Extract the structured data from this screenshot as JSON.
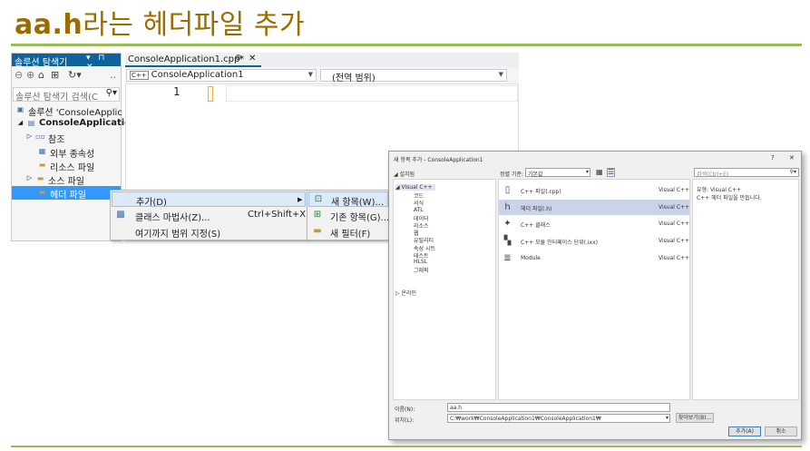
{
  "slide": {
    "title_bold": "aa.h",
    "title_rest": "라는 헤더파일 추가",
    "title_color": "#9c6b00",
    "accent_rule_color": "#9bbb59"
  },
  "solution_explorer": {
    "title": "솔루션 탐색기",
    "header_buttons": "▾ ⊓ ✕",
    "search_placeholder": "솔루션 탐색기 검색(C",
    "tree": [
      {
        "label": "솔루션 'ConsoleApplic",
        "icon": "solution-icon",
        "bold": false
      },
      {
        "label": "ConsoleApplicatic",
        "icon": "project-icon",
        "bold": true,
        "expander": "◢"
      },
      {
        "label": "참조",
        "icon": "references-icon",
        "expander": "▷"
      },
      {
        "label": "외부 종속성",
        "icon": "external-deps-icon"
      },
      {
        "label": "리소스 파일",
        "icon": "folder-icon"
      },
      {
        "label": "소스 파일",
        "icon": "folder-icon",
        "expander": "▷"
      },
      {
        "label": "헤더 파일",
        "icon": "folder-icon",
        "selected": true
      }
    ]
  },
  "editor": {
    "tab_label": "ConsoleApplication1.cpp*",
    "tab_pin": "⊕",
    "tab_close": "✕",
    "project_combo": "ConsoleApplication1",
    "scope_combo": "(전역 범위)",
    "line_number": "1"
  },
  "context_menu": {
    "items": [
      {
        "label": "추가(D)",
        "shortcut": "",
        "has_submenu": true,
        "highlighted": true
      },
      {
        "label": "클래스 마법사(Z)...",
        "shortcut": "Ctrl+Shift+X",
        "icon": "class-wizard-icon"
      },
      {
        "label": "여기까지 범위 지정(S)",
        "shortcut": ""
      }
    ],
    "submenu": [
      {
        "label": "새 항목(W)...",
        "icon": "new-item-icon",
        "highlighted": true
      },
      {
        "label": "기존 항목(G)...",
        "icon": "existing-item-icon"
      },
      {
        "label": "새 필터(F)",
        "icon": "new-filter-icon"
      }
    ]
  },
  "dialog": {
    "title": "새 항목 추가 - ConsoleApplication1",
    "help": "?",
    "close": "✕",
    "installed_label": "◢ 설치됨",
    "sort_label": "정렬 기준:",
    "sort_value": "기본값",
    "search_placeholder": "검색(Ctrl+E)",
    "left_tree": [
      "◢ Visual C++",
      "코드",
      "서식",
      "ATL",
      "데이터",
      "리소스",
      "웹",
      "유틸리티",
      "속성 시트",
      "테스트",
      "HLSL",
      "그래픽"
    ],
    "online": "▷ 온라인",
    "templates": [
      {
        "name": "C++ 파일(.cpp)",
        "lang": "Visual C++",
        "icon": "cpp-file-icon"
      },
      {
        "name": "헤더 파일(.h)",
        "lang": "Visual C++",
        "icon": "header-file-icon",
        "selected": true
      },
      {
        "name": "C++ 클래스",
        "lang": "Visual C++",
        "icon": "cpp-class-icon"
      },
      {
        "name": "C++ 모듈 인터페이스 단위(.ixx)",
        "lang": "Visual C++",
        "icon": "module-interface-icon"
      },
      {
        "name": "Module",
        "lang": "Visual C++",
        "icon": "module-icon"
      }
    ],
    "detail_type": "유형: Visual C++",
    "detail_desc": "C++ 헤더 파일을 만듭니다.",
    "name_label": "이름(N):",
    "name_value": "aa.h",
    "location_label": "위치(L):",
    "location_value": "C:₩work₩ConsoleApplication1₩ConsoleApplication1₩",
    "browse_button": "찾아보기(B)...",
    "add_button": "추가(A)",
    "cancel_button": "취소"
  }
}
